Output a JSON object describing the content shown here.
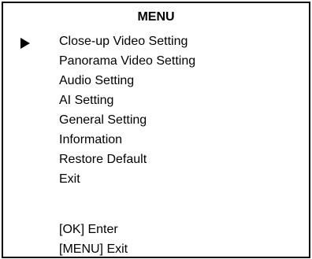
{
  "menu": {
    "title": "MENU",
    "selector_icon": "right-triangle-icon",
    "selected_index": 0,
    "items": [
      {
        "label": "Close-up Video Setting"
      },
      {
        "label": "Panorama Video Setting"
      },
      {
        "label": "Audio Setting"
      },
      {
        "label": "AI Setting"
      },
      {
        "label": "General Setting"
      },
      {
        "label": "Information"
      },
      {
        "label": "Restore Default"
      },
      {
        "label": "Exit"
      }
    ]
  },
  "hints": {
    "enter": "[OK] Enter",
    "exit": "[MENU] Exit"
  }
}
